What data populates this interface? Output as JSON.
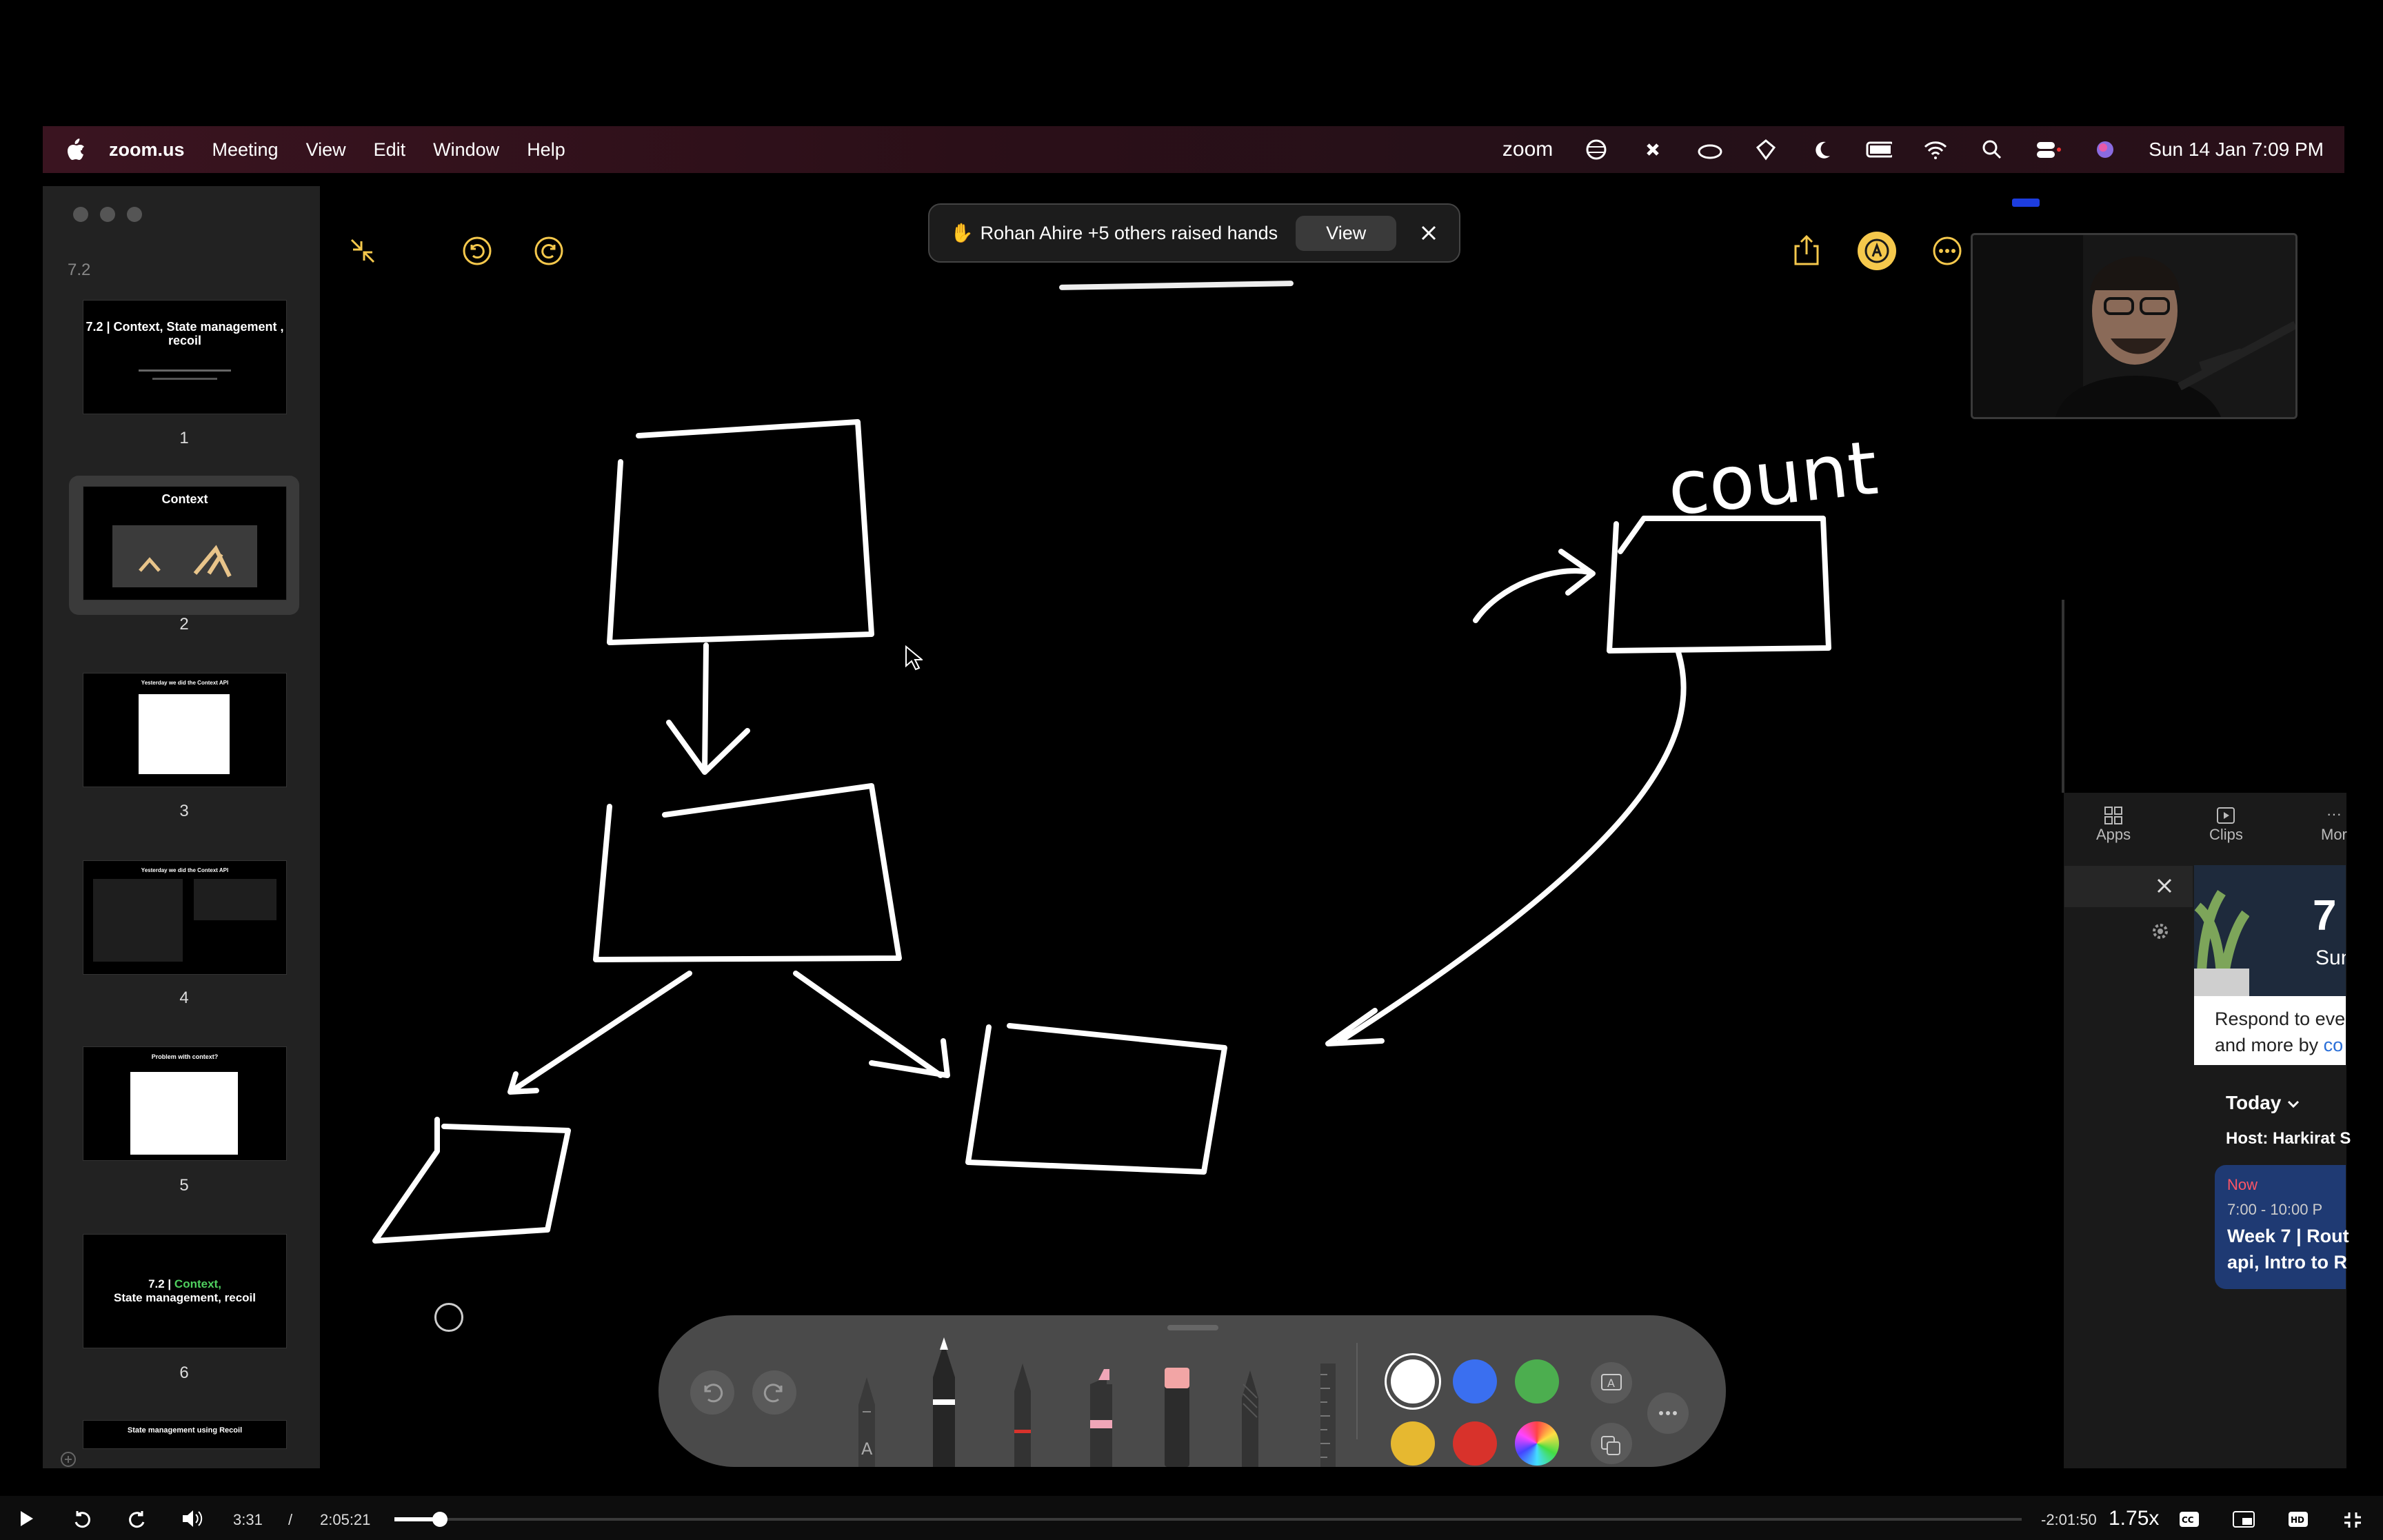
{
  "menubar": {
    "apple_icon": "apple-logo-icon",
    "app_name": "zoom.us",
    "items": [
      "Meeting",
      "View",
      "Edit",
      "Window",
      "Help"
    ],
    "right_brand": "zoom",
    "datetime": "Sun 14 Jan  7:09 PM"
  },
  "sidebar": {
    "section_label": "7.2",
    "slides": [
      {
        "num": "1",
        "title": "7.2 | Context, State management , recoil",
        "selected": false
      },
      {
        "num": "2",
        "title": "Context",
        "selected": true
      },
      {
        "num": "3",
        "title": "Yesterday we did the Context API",
        "selected": false
      },
      {
        "num": "4",
        "title": "Yesterday we did the Context API",
        "selected": false
      },
      {
        "num": "5",
        "title": "Problem with context?",
        "selected": false
      },
      {
        "num": "6",
        "title_a": "7.2 | ",
        "title_b": "Context,",
        "title_c": "State management, recoil",
        "selected": false
      },
      {
        "num": "7",
        "title": "State management using Recoil",
        "selected": false
      }
    ]
  },
  "notification": {
    "emoji": "✋",
    "text": "Rohan Ahire +5 others raised hands",
    "view_label": "View"
  },
  "canvas": {
    "handwritten_label": "count"
  },
  "right_panel": {
    "tabs": [
      "Apps",
      "Clips",
      "Mor"
    ],
    "card_day": "7",
    "card_weekday": "Sun",
    "card_text_1": "Respond to eve",
    "card_text_2": "and more by ",
    "card_link": "co",
    "today_label": "Today",
    "host_label": "Host: Harkirat S",
    "event_now": "Now",
    "event_time": "7:00 - 10:00 P",
    "event_title_1": "Week 7 | Rout",
    "event_title_2": "api, Intro to R"
  },
  "colors": {
    "white": "#ffffff",
    "blue": "#3a6ff0",
    "green": "#4cae4f",
    "yellow": "#e6b830",
    "red": "#d8322b",
    "accent_yellow": "#f5c84c",
    "event_bg": "#1f3a73",
    "now_red": "#ff5566"
  },
  "player": {
    "current_time": "3:31",
    "separator": "/",
    "duration": "2:05:21",
    "remaining": "-2:01:50",
    "speed": "1.75x",
    "progress_fraction": 0.028
  }
}
